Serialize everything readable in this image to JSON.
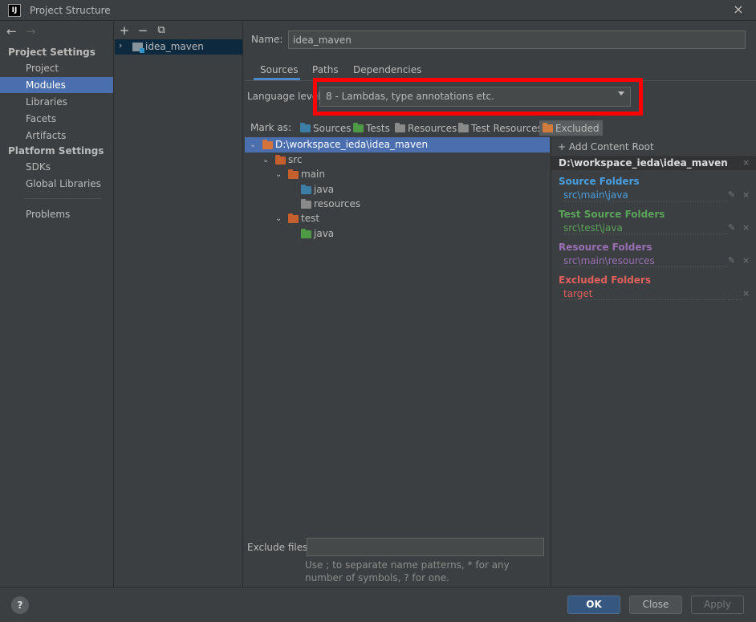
{
  "window": {
    "title": "Project Structure",
    "app_icon_text": "IJ"
  },
  "sidebar": {
    "back_arrow": "←",
    "forward_arrow": "→",
    "project_settings_heading": "Project Settings",
    "project_settings_items": [
      {
        "label": "Project",
        "selected": false
      },
      {
        "label": "Modules",
        "selected": true
      },
      {
        "label": "Libraries",
        "selected": false
      },
      {
        "label": "Facets",
        "selected": false
      },
      {
        "label": "Artifacts",
        "selected": false
      }
    ],
    "platform_settings_heading": "Platform Settings",
    "platform_settings_items": [
      {
        "label": "SDKs"
      },
      {
        "label": "Global Libraries"
      }
    ],
    "problems_label": "Problems"
  },
  "modules": {
    "add_icon": "+",
    "remove_icon": "−",
    "copy_icon": "⧉",
    "items": [
      {
        "name": "idea_maven",
        "chevron": "›"
      }
    ]
  },
  "main": {
    "name_label": "Name:",
    "name_value": "idea_maven",
    "tabs": [
      {
        "label": "Sources",
        "active": true
      },
      {
        "label": "Paths",
        "active": false
      },
      {
        "label": "Dependencies",
        "active": false
      }
    ],
    "language_level_label": "Language level:",
    "language_level_value": "8 - Lambdas, type annotations etc.",
    "mark_as_label": "Mark as:",
    "mark_as_buttons": [
      {
        "label": "Sources",
        "color": "#3c7ea6"
      },
      {
        "label": "Tests",
        "color": "#4e9a45"
      },
      {
        "label": "Resources",
        "color": "#8a8a8a"
      },
      {
        "label": "Test Resources",
        "color": "#8a8a8a"
      },
      {
        "label": "Excluded",
        "color": "#d17c3c",
        "selected": true
      }
    ],
    "tree": [
      {
        "label": "D:\\workspace_ieda\\idea_maven",
        "chevron": "⌄",
        "folder_color": "#d4733a",
        "selected": true
      },
      {
        "label": "src",
        "chevron": "⌄",
        "folder_color": "#c65f2e"
      },
      {
        "label": "main",
        "chevron": "⌄",
        "folder_color": "#c65f2e"
      },
      {
        "label": "java",
        "chevron": "",
        "folder_color": "#3c7ea6"
      },
      {
        "label": "resources",
        "chevron": "",
        "folder_color": "#8a8a8a"
      },
      {
        "label": "test",
        "chevron": "⌄",
        "folder_color": "#c65f2e"
      },
      {
        "label": "java",
        "chevron": "",
        "folder_color": "#4e9a45"
      }
    ],
    "exclude_files_label": "Exclude files:",
    "exclude_files_value": "",
    "exclude_hint": "Use ; to separate name patterns, * for any number of symbols, ? for one."
  },
  "content_root": {
    "add_label": "+ Add Content Root",
    "root_path": "D:\\workspace_ieda\\idea_maven",
    "remove_icon": "×",
    "edit_icon": "✎",
    "sections": [
      {
        "title": "Source Folders",
        "path": "src\\main\\java",
        "title_color": "#4a9fe0",
        "path_color": "#4a9fe0"
      },
      {
        "title": "Test Source Folders",
        "path": "src\\test\\java",
        "title_color": "#5aa45a",
        "path_color": "#5aa45a"
      },
      {
        "title": "Resource Folders",
        "path": "src\\main\\resources",
        "title_color": "#9a6fb5",
        "path_color": "#9a6fb5"
      },
      {
        "title": "Excluded Folders",
        "path": "target",
        "title_color": "#e0605c",
        "path_color": "#e0605c"
      }
    ]
  },
  "footer": {
    "help_label": "?",
    "ok_label": "OK",
    "close_label": "Close",
    "apply_label": "Apply"
  },
  "colors": {
    "accent": "#4b6eaf",
    "highlight": "#ff0000",
    "background": "#3c3f41"
  }
}
